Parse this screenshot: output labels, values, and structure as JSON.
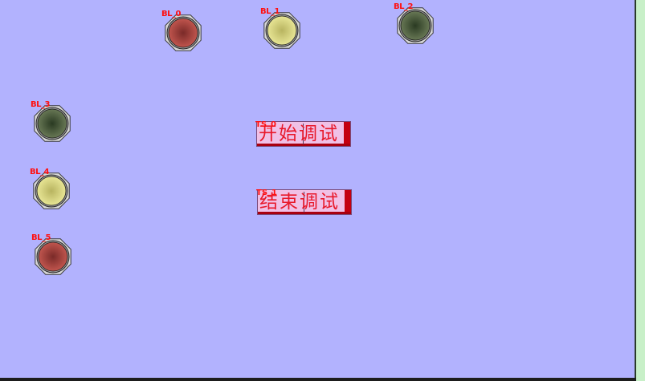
{
  "lamps": [
    {
      "tag": "BL_0",
      "color": "#7a2a28",
      "highlight": "#c85a52"
    },
    {
      "tag": "BL_1",
      "color": "#b8b460",
      "highlight": "#ecea9a"
    },
    {
      "tag": "BL_2",
      "color": "#2a3a22",
      "highlight": "#6e7e5a"
    },
    {
      "tag": "BL_3",
      "color": "#2a3a22",
      "highlight": "#6e7e5a"
    },
    {
      "tag": "BL_4",
      "color": "#b8b460",
      "highlight": "#ecea9a"
    },
    {
      "tag": "BL_5",
      "color": "#7a2a28",
      "highlight": "#c85a52"
    }
  ],
  "buttons": {
    "start": {
      "tag": "TS_0",
      "label": "开始调试"
    },
    "end": {
      "tag": "TS_1",
      "label": "结束调试"
    }
  },
  "colors": {
    "background": "#b2b2fe",
    "button_face": "#f0c0e6",
    "button_text": "#e8182a",
    "tag_text": "#ff1010"
  }
}
